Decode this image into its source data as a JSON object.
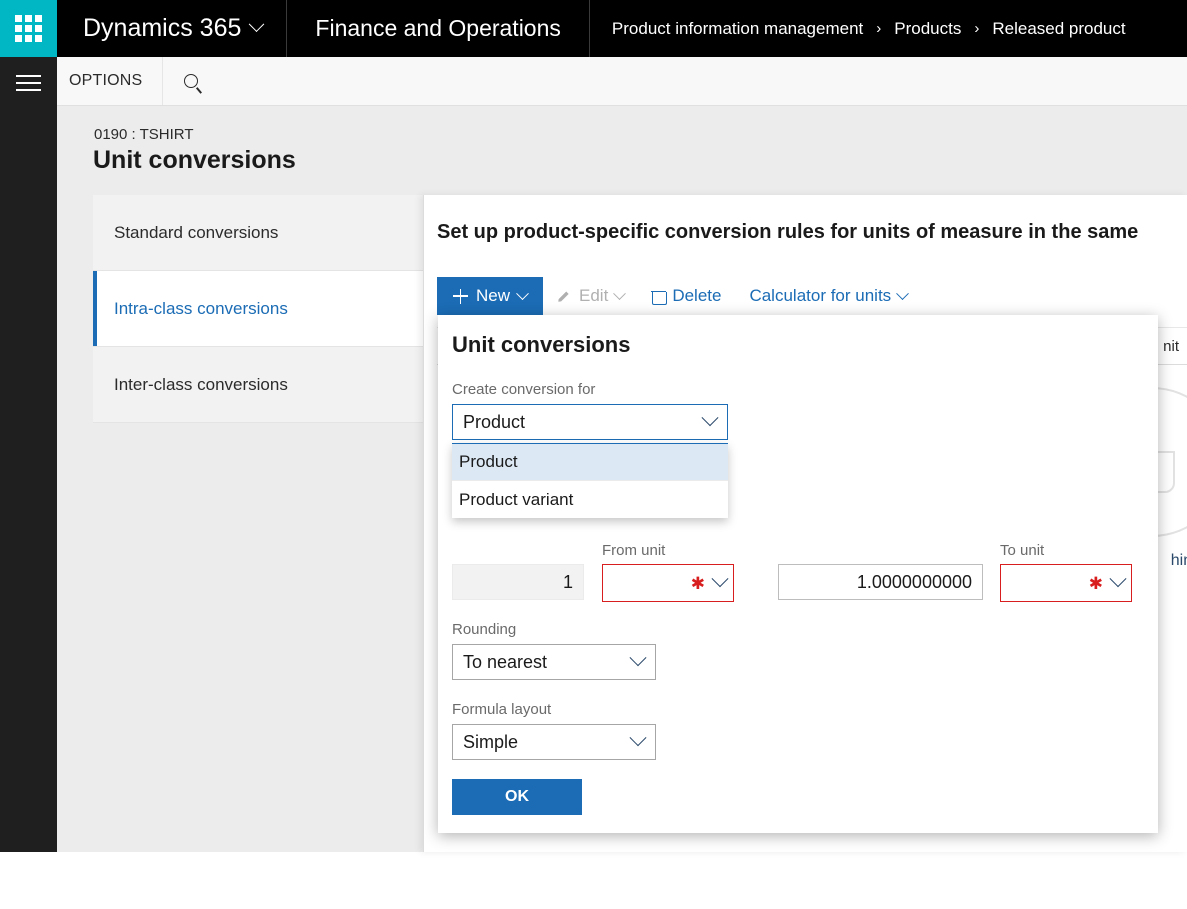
{
  "topbar": {
    "waffle_icon": "app-launcher-icon",
    "brand": "Dynamics 365",
    "brand_chevron_icon": "chevron-down-icon",
    "app_name": "Finance and Operations",
    "breadcrumb": [
      "Product information management",
      "Products",
      "Released product"
    ],
    "breadcrumb_separator": "›"
  },
  "rail": {
    "menu_icon": "hamburger-icon"
  },
  "optionsbar": {
    "options_label": "OPTIONS",
    "search_icon": "search-icon"
  },
  "pagehead": {
    "record_id": "0190 : TSHIRT",
    "title": "Unit conversions"
  },
  "tabs": [
    {
      "label": "Standard conversions",
      "selected": false
    },
    {
      "label": "Intra-class conversions",
      "selected": true
    },
    {
      "label": "Inter-class conversions",
      "selected": false
    }
  ],
  "content": {
    "heading": "Set up product-specific conversion rules for units of measure in the same"
  },
  "toolbar": {
    "new_label": "New",
    "new_icon": "plus-icon",
    "new_chevron_icon": "chevron-down-icon",
    "edit_label": "Edit",
    "edit_icon": "pencil-icon",
    "edit_chevron_icon": "chevron-down-icon",
    "delete_label": "Delete",
    "delete_icon": "trash-icon",
    "calculator_label": "Calculator for units",
    "calculator_chevron_icon": "chevron-down-icon"
  },
  "background_grid": {
    "column_header_partial": "nit",
    "watermark_icon": "empty-cup-icon",
    "note_partial": "hing"
  },
  "dialog": {
    "title": "Unit conversions",
    "create_for": {
      "label": "Create conversion for",
      "value": "Product",
      "chevron_icon": "chevron-down-icon",
      "options": [
        "Product",
        "Product variant"
      ],
      "highlighted_option": "Product"
    },
    "factor_from": {
      "value": "1",
      "readonly": true
    },
    "from_unit": {
      "label": "From unit",
      "value": "",
      "required_icon": "required-asterisk-icon",
      "chevron_icon": "chevron-down-icon"
    },
    "equals": "=",
    "factor_to": {
      "value": "1.0000000000"
    },
    "to_unit": {
      "label": "To unit",
      "value": "",
      "required_icon": "required-asterisk-icon",
      "chevron_icon": "chevron-down-icon"
    },
    "rounding": {
      "label": "Rounding",
      "value": "To nearest",
      "chevron_icon": "chevron-down-icon"
    },
    "formula_layout": {
      "label": "Formula layout",
      "value": "Simple",
      "chevron_icon": "chevron-down-icon"
    },
    "ok_label": "OK"
  },
  "colors": {
    "accent_teal": "#00b7c3",
    "accent_blue": "#1b6cb5",
    "required_red": "#d81e1e",
    "topbar_black": "#000000",
    "rail_dark": "#1f1f1f",
    "surface_gray": "#ececec"
  }
}
